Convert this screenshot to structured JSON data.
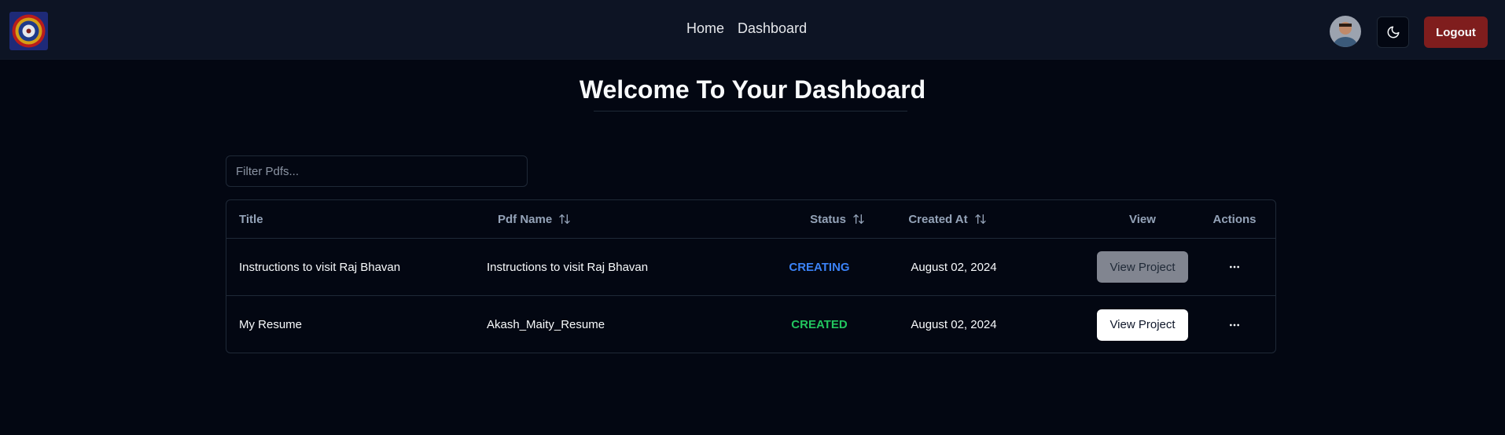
{
  "nav": {
    "links": [
      "Home",
      "Dashboard"
    ],
    "logout_label": "Logout"
  },
  "page": {
    "title": "Welcome To Your Dashboard"
  },
  "filter": {
    "placeholder": "Filter Pdfs...",
    "value": ""
  },
  "table": {
    "headers": {
      "title": "Title",
      "pdf_name": "Pdf Name",
      "status": "Status",
      "created_at": "Created At",
      "view": "View",
      "actions": "Actions"
    },
    "rows": [
      {
        "title": "Instructions to visit Raj Bhavan",
        "pdf_name": "Instructions to visit Raj Bhavan",
        "status": "CREATING",
        "created_at": "August 02, 2024",
        "view_label": "View Project",
        "view_enabled": false
      },
      {
        "title": "My Resume",
        "pdf_name": "Akash_Maity_Resume",
        "status": "CREATED",
        "created_at": "August 02, 2024",
        "view_label": "View Project",
        "view_enabled": true
      }
    ]
  },
  "colors": {
    "background": "#030712",
    "navbar": "#0d1424",
    "logout": "#7f1d1d",
    "status_creating": "#3b82f6",
    "status_created": "#22c55e"
  },
  "icons": {
    "theme_toggle": "moon-icon",
    "sort": "arrow-up-down-icon",
    "actions": "ellipsis-icon"
  }
}
